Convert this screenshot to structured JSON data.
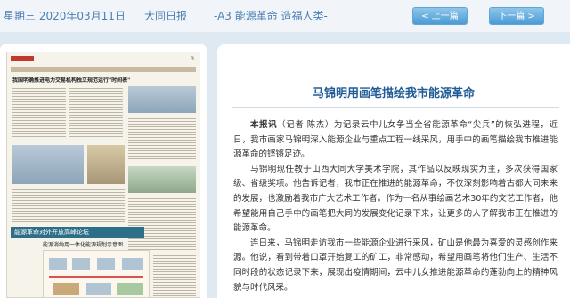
{
  "header": {
    "date": "星期三 2020年03月11日",
    "paper_name": "大同日报",
    "page_name": "-A3 能源革命 造福人类-",
    "prev_label": "< 上一篇",
    "next_label": "下一篇 >"
  },
  "thumbnail": {
    "page_number": "3",
    "headline": "我国明确推进电力交易机构独立规范运行\"时间表\"",
    "banner": "能源革命对外开放高峰论坛",
    "diagram_title": "能源消纳用一体化能源规划示意图"
  },
  "article": {
    "title": "马锦明用画笔描绘我市能源革命",
    "lead": "本报讯",
    "paragraphs": [
      "（记者 陈杰）为记录云中儿女争当全省能源革命“尖兵”的恢弘进程，近日，我市画家马锦明深入能源企业与重点工程一线采风，用手中的画笔描绘我市推进能源革命的铿锵足迹。",
      "马锦明现任教于山西大同大学美术学院，其作品以反映现实为主，多次获得国家级、省级奖项。他告诉记者，我市正在推进的能源革命，不仅深刻影响着古都大同未来的发展，也激励着我市广大艺术工作者。作为一名从事绘画艺术30年的文艺工作者，他希望能用自己手中的画笔把大同的发展变化记录下来，让更多的人了解我市正在推进的能源革命。",
      "连日来，马锦明走访我市一些能源企业进行采风，矿山是他最为喜爱的灵感创作来源。他说，看到带着口罩开始复工的矿工，非常感动，希望用画笔将他们生产、生活不同时段的状态记录下来，展现出疫情期间，云中儿女推进能源革命的蓬勃向上的精神风貌与时代风采。"
    ]
  }
}
